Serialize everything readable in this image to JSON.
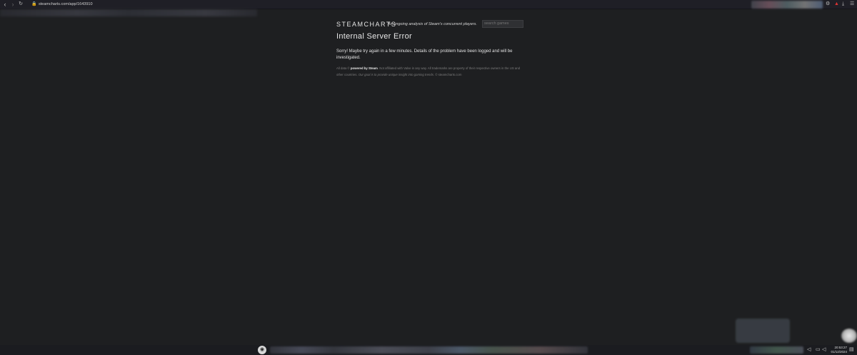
{
  "browser": {
    "url": "steamcharts.com/app/1643910",
    "back_icon": "back-arrow-icon",
    "forward_icon": "forward-arrow-icon",
    "reload_icon": "reload-icon"
  },
  "site": {
    "logo": "STEAMCHARTS",
    "tagline": "An ongoing analysis of Steam's concurrent players.",
    "search_placeholder": "search games"
  },
  "error": {
    "title": "Internal Server Error",
    "message": "Sorry! Maybe try again in a few minutes. Details of the problem have been logged and will be investigated."
  },
  "footer": {
    "prefix": "All data ",
    "copy_sign": "©",
    "powered_by": "powered by Steam",
    "disclaimer": ". Not affiliated with Valve in any way. All trademarks are property of their respective owners in the US and other countries.",
    "goal": " Our goal is to provide unique insight into gaming trends.",
    "copyright": " © steamcharts.com"
  },
  "taskbar": {
    "time": "20:53:27",
    "date": "01/12/2024"
  },
  "colors": {
    "background": "#1e1f21",
    "text": "#e2e2e2",
    "muted": "#7d7d7d"
  }
}
